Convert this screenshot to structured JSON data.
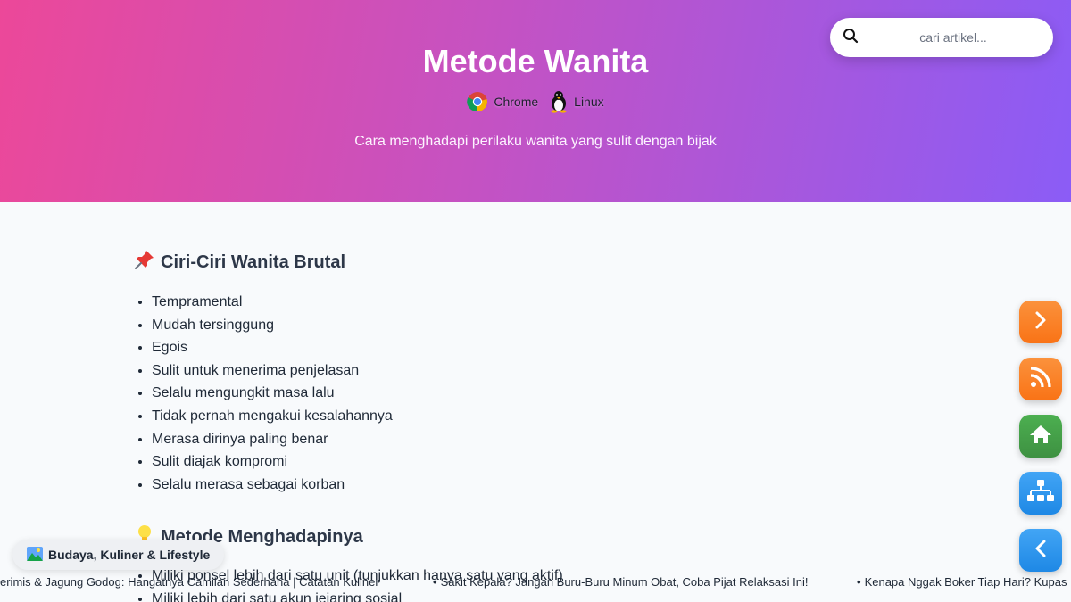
{
  "header": {
    "title": "Metode Wanita",
    "subtitle": "Cara menghadapi perilaku wanita yang sulit dengan bijak",
    "badges": [
      {
        "label": "Chrome",
        "icon": "chrome-icon"
      },
      {
        "label": "Linux",
        "icon": "linux-tux-icon"
      }
    ]
  },
  "search": {
    "placeholder": "cari artikel..."
  },
  "sections": [
    {
      "icon": "pushpin-icon",
      "title": "Ciri-Ciri Wanita Brutal",
      "items": [
        "Tempramental",
        "Mudah tersinggung",
        "Egois",
        "Sulit untuk menerima penjelasan",
        "Selalu mengungkit masa lalu",
        "Tidak pernah mengakui kesalahannya",
        "Merasa dirinya paling benar",
        "Sulit diajak kompromi",
        "Selalu merasa sebagai korban"
      ]
    },
    {
      "icon": "lightbulb-icon",
      "title": "Metode Menghadapinya",
      "items": [
        "Miliki ponsel lebih dari satu unit (tunjukkan hanya satu yang aktif)",
        "Miliki lebih dari satu akun jejaring sosial"
      ]
    }
  ],
  "category": {
    "icon": "landscape-icon",
    "label": "Budaya, Kuliner & Lifestyle"
  },
  "ticker": [
    "erimis & Jagung Godog: Hangatnya Camilan Sederhana | Catatan Kuliner",
    "Sakit Kepala? Jangan Buru-Buru Minum Obat, Coba Pijat Relaksasi Ini!",
    "Kenapa Nggak Boker Tiap Hari? Kupas"
  ],
  "fabs": [
    {
      "name": "next-button",
      "icon": "chevron-right-icon",
      "color": "#f97316"
    },
    {
      "name": "rss-button",
      "icon": "rss-icon",
      "color": "#f97316"
    },
    {
      "name": "home-button",
      "icon": "home-icon",
      "color": "#43a047"
    },
    {
      "name": "sitemap-button",
      "icon": "sitemap-icon",
      "color": "#1e88e5"
    },
    {
      "name": "prev-button",
      "icon": "chevron-left-icon",
      "color": "#1e88e5"
    }
  ],
  "colors": {
    "hero_gradient_start": "#ec4899",
    "hero_gradient_end": "#8b5cf6",
    "background": "#f8fafc"
  }
}
